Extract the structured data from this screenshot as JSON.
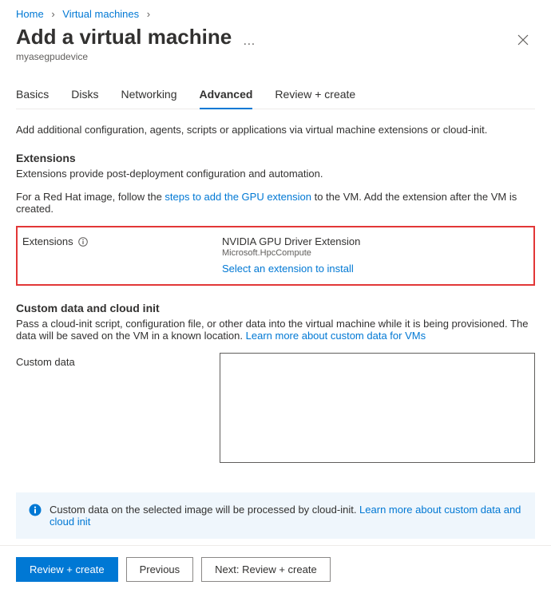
{
  "breadcrumb": {
    "home": "Home",
    "vms": "Virtual machines"
  },
  "header": {
    "title": "Add a virtual machine",
    "subtitle": "myasegpudevice"
  },
  "tabs": {
    "basics": "Basics",
    "disks": "Disks",
    "networking": "Networking",
    "advanced": "Advanced",
    "review": "Review + create"
  },
  "advanced": {
    "intro": "Add additional configuration, agents, scripts or applications via virtual machine extensions or cloud-init.",
    "extensions_heading": "Extensions",
    "extensions_desc": "Extensions provide post-deployment configuration and automation.",
    "redhat_pre": "For a Red Hat image, follow the ",
    "redhat_link": "steps to add the GPU extension",
    "redhat_post": " to the VM. Add the extension after the VM is created.",
    "extensions_label": "Extensions",
    "extension_name": "NVIDIA GPU Driver Extension",
    "extension_publisher": "Microsoft.HpcCompute",
    "select_extension_link": "Select an extension to install",
    "customdata_heading": "Custom data and cloud init",
    "customdata_desc_pre": "Pass a cloud-init script, configuration file, or other data into the virtual machine while it is being provisioned. The data will be saved on the VM in a known location. ",
    "customdata_desc_link": "Learn more about custom data for VMs",
    "customdata_label": "Custom data",
    "customdata_value": "",
    "infobox_pre": "Custom data on the selected image will be processed by cloud-init. ",
    "infobox_link": "Learn more about custom data and cloud init"
  },
  "footer": {
    "review": "Review + create",
    "previous": "Previous",
    "next": "Next: Review + create"
  }
}
